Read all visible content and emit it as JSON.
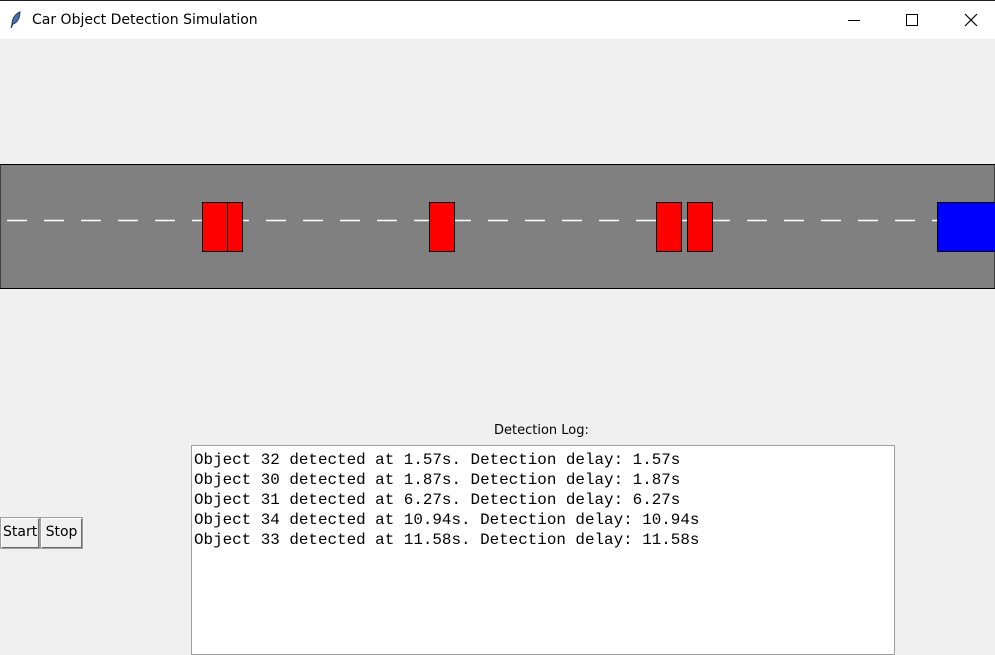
{
  "window": {
    "title": "Car Object Detection Simulation",
    "app_icon": "feather-icon",
    "controls": [
      "minimize-icon",
      "maximize-icon",
      "close-icon"
    ]
  },
  "scene": {
    "road_color": "#808080",
    "lane_marking_color": "#ffffff",
    "obstacle_color": "#ff0000",
    "player_car_color": "#0000ff",
    "obstacle_count": 5,
    "player_car_count": 1
  },
  "log": {
    "label": "Detection Log:",
    "lines": [
      "Object 32 detected at 1.57s. Detection delay: 1.57s",
      "Object 30 detected at 1.87s. Detection delay: 1.87s",
      "Object 31 detected at 6.27s. Detection delay: 6.27s",
      "Object 34 detected at 10.94s. Detection delay: 10.94s",
      "Object 33 detected at 11.58s. Detection delay: 11.58s"
    ]
  },
  "buttons": {
    "start": "Start",
    "stop": "Stop"
  }
}
